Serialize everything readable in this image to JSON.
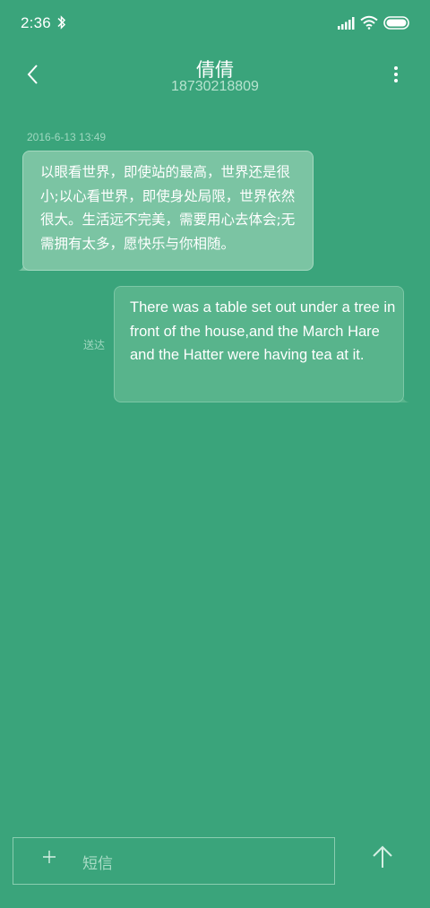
{
  "status_bar": {
    "time": "2:36"
  },
  "header": {
    "contact_name": "倩倩",
    "phone_number": "18730218809"
  },
  "conversation": {
    "timestamp": "2016-6-13 13:49",
    "incoming_message": "以眼看世界，即使站的最高，世界还是很小;以心看世界，即使身处局限，世界依然很大。生活远不完美，需要用心去体会;无需拥有太多，愿快乐与你相随。",
    "outgoing_message": "There was a table set out under a tree in front of the house,and the March Hare and the Hatter were having tea at it.",
    "outgoing_status": "送达"
  },
  "compose": {
    "placeholder": "短信"
  },
  "colors": {
    "background": "#3aa47b",
    "incoming_bubble": "#7bc4a3",
    "outgoing_bubble": "#58b48c"
  },
  "icons": [
    "bluetooth-icon",
    "signal-icon",
    "wifi-icon",
    "battery-icon",
    "back-arrow-icon",
    "more-vertical-icon",
    "plus-icon",
    "send-arrow-icon"
  ]
}
